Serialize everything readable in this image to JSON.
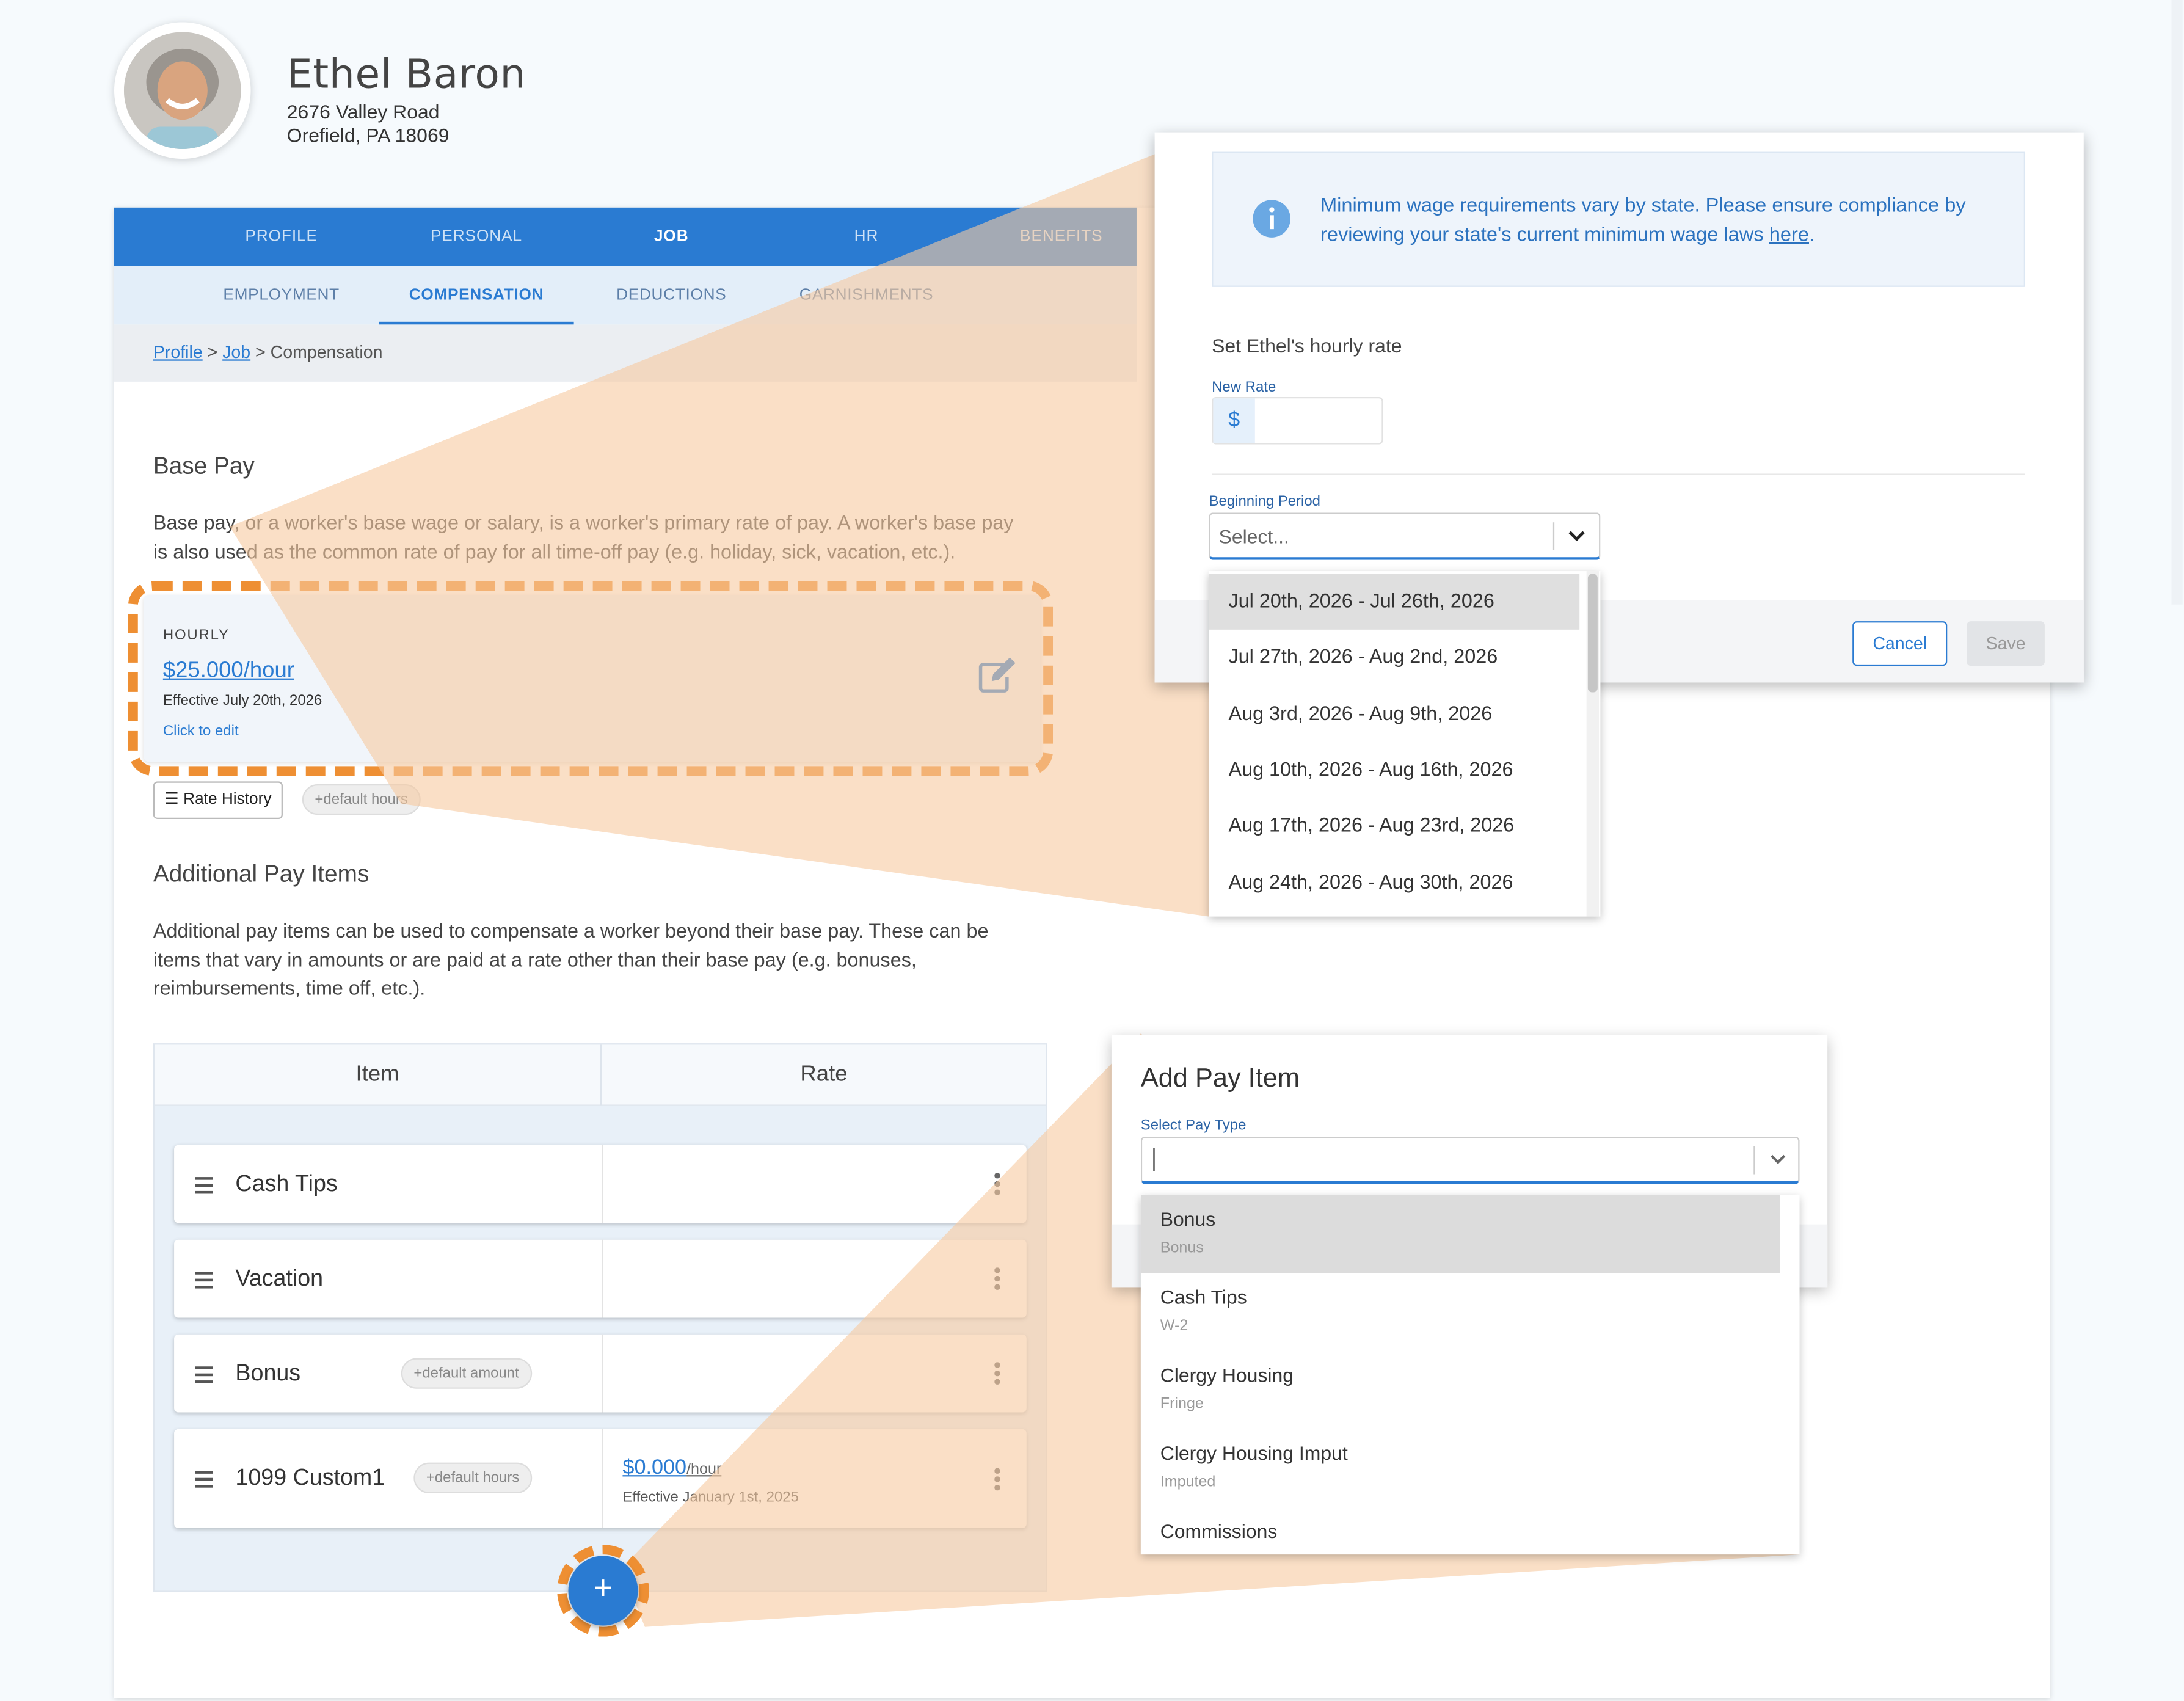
{
  "employee": {
    "name": "Ethel Baron",
    "address_line1": "2676 Valley Road",
    "address_line2": "Orefield, PA 18069"
  },
  "tabs": [
    "PROFILE",
    "PERSONAL",
    "JOB",
    "HR",
    "BENEFITS"
  ],
  "active_tab": "JOB",
  "subtabs": [
    "EMPLOYMENT",
    "COMPENSATION",
    "DEDUCTIONS",
    "GARNISHMENTS"
  ],
  "active_subtab": "COMPENSATION",
  "breadcrumb": {
    "profile": "Profile",
    "job": "Job",
    "sep": " > ",
    "current": "Compensation"
  },
  "base_pay": {
    "title": "Base Pay",
    "description": "Base pay, or a worker's base wage or salary, is a worker's primary rate of pay. A worker's base pay is also used as the common rate of pay for all time-off pay (e.g. holiday, sick, vacation, etc.).",
    "rate_type": "HOURLY",
    "rate": "$25.000/hour",
    "effective": "Effective July 20th, 2026",
    "click_to_edit": "Click to edit",
    "rate_history": "Rate History",
    "default_hours": "default hours"
  },
  "additional": {
    "title": "Additional Pay Items",
    "description": "Additional pay items can be used to compensate a worker beyond their base pay. These can be items that vary in amounts or are paid at a rate other than their base pay (e.g. bonuses, reimbursements, time off, etc.).",
    "col_item": "Item",
    "col_rate": "Rate",
    "rows": [
      {
        "label": "Cash Tips"
      },
      {
        "label": "Vacation"
      },
      {
        "label": "Bonus",
        "chip": "default amount"
      },
      {
        "label": "1099 Custom1",
        "chip": "default hours",
        "rate": "$0.000",
        "rate_unit": "/hour",
        "effective": "Effective January 1st, 2025"
      }
    ],
    "add_symbol": "+"
  },
  "rate_modal": {
    "alert_text": "Minimum wage requirements vary by state. Please ensure compliance by reviewing your state's current minimum wage laws ",
    "alert_link": "here",
    "alert_end": ".",
    "heading": "Set Ethel's hourly rate",
    "new_rate_label": "New Rate",
    "currency": "$",
    "new_rate_value": "",
    "beginning_period_label": "Beginning Period",
    "select_placeholder": "Select...",
    "cancel": "Cancel",
    "save": "Save",
    "period_options": [
      "Jul 20th, 2026 - Jul 26th, 2026",
      "Jul 27th, 2026 - Aug 2nd, 2026",
      "Aug 3rd, 2026 - Aug 9th, 2026",
      "Aug 10th, 2026 - Aug 16th, 2026",
      "Aug 17th, 2026 - Aug 23rd, 2026",
      "Aug 24th, 2026 - Aug 30th, 2026"
    ]
  },
  "add_modal": {
    "title": "Add Pay Item",
    "select_label": "Select Pay Type",
    "input_value": "",
    "options": [
      {
        "title": "Bonus",
        "sub": "Bonus"
      },
      {
        "title": "Cash Tips",
        "sub": "W-2"
      },
      {
        "title": "Clergy Housing",
        "sub": "Fringe"
      },
      {
        "title": "Clergy Housing Imput",
        "sub": "Imputed"
      },
      {
        "title": "Commissions",
        "sub": ""
      }
    ]
  },
  "colors": {
    "primary": "#2a7bd2",
    "highlight": "#ee8f33",
    "callout": "#f6c9a0"
  }
}
